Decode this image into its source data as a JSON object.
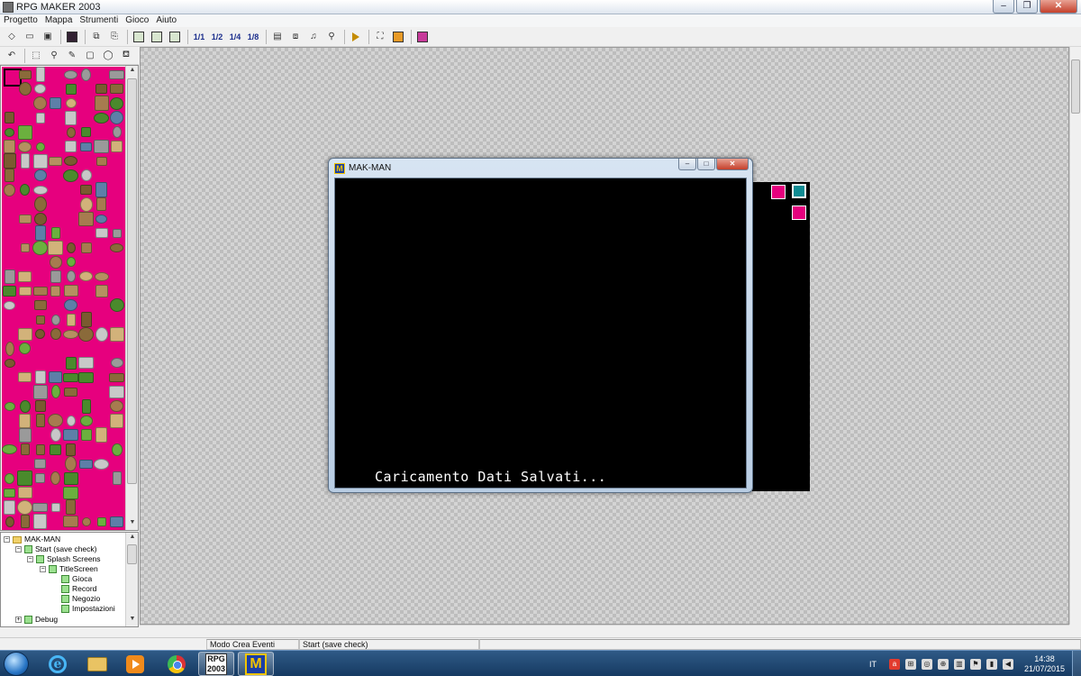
{
  "window": {
    "title": "RPG MAKER 2003",
    "minimize": "–",
    "maximize": "❐",
    "close": "✕"
  },
  "menu": [
    {
      "label": "Progetto"
    },
    {
      "label": "Mappa"
    },
    {
      "label": "Strumenti"
    },
    {
      "label": "Gioco"
    },
    {
      "label": "Aiuto"
    }
  ],
  "toolbar": {
    "layers": [
      "1/1",
      "1/2",
      "1/4",
      "1/8"
    ],
    "icons": [
      "new-icon",
      "open-icon",
      "close-project-icon",
      "save-icon",
      "cut-icon",
      "paste-icon",
      "lower-layer-icon",
      "upper-layer-icon",
      "event-layer-icon",
      "zoom-1-1-icon",
      "zoom-1-2-icon",
      "zoom-1-4-icon",
      "zoom-1-8-icon",
      "database-icon",
      "material-icon",
      "music-icon",
      "search-icon",
      "play-test-icon",
      "fullscreen-icon",
      "title-icon",
      "help-icon"
    ]
  },
  "tree": {
    "items": [
      {
        "label": "MAK-MAN",
        "level": 0,
        "type": "folder",
        "toggle": "−"
      },
      {
        "label": "Start (save check)",
        "level": 1,
        "type": "map",
        "toggle": "−"
      },
      {
        "label": "Splash Screens",
        "level": 2,
        "type": "map",
        "toggle": "−"
      },
      {
        "label": "TitleScreen",
        "level": 3,
        "type": "map",
        "toggle": "−"
      },
      {
        "label": "Gioca",
        "level": 4,
        "type": "map",
        "toggle": ""
      },
      {
        "label": "Record",
        "level": 4,
        "type": "map",
        "toggle": ""
      },
      {
        "label": "Negozio",
        "level": 4,
        "type": "map",
        "toggle": ""
      },
      {
        "label": "Impostazioni",
        "level": 4,
        "type": "map",
        "toggle": ""
      },
      {
        "label": "Debug",
        "level": 1,
        "type": "map",
        "toggle": "+"
      }
    ]
  },
  "game_window": {
    "title": "MAK-MAN",
    "icon_letter": "M",
    "message": "Caricamento Dati Salvati...",
    "minimize": "–",
    "maximize": "□",
    "close": "✕"
  },
  "status": {
    "mode": "Modo Crea Eventi",
    "map": "Start (save check)"
  },
  "taskbar": {
    "rpg_label": "RPG\n2003",
    "mak_letter": "M",
    "lang": "IT",
    "time": "14:38",
    "date": "21/07/2015"
  },
  "colors": {
    "tile_bg": "#e6007e",
    "event": "#e6007e",
    "event_selected": "#0f8c93"
  }
}
